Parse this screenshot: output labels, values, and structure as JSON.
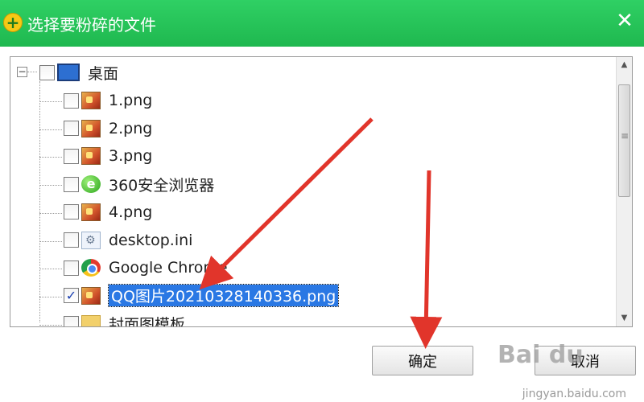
{
  "window": {
    "title": "选择要粉碎的文件",
    "close_label": "✕"
  },
  "tree": {
    "root": {
      "label": "桌面",
      "expander": "−",
      "checked": false
    },
    "items": [
      {
        "label": "1.png",
        "icon": "image-icon",
        "checked": false,
        "selected": false
      },
      {
        "label": "2.png",
        "icon": "image-icon",
        "checked": false,
        "selected": false
      },
      {
        "label": "3.png",
        "icon": "image-icon",
        "checked": false,
        "selected": false
      },
      {
        "label": "360安全浏览器",
        "icon": "360-browser-icon",
        "checked": false,
        "selected": false
      },
      {
        "label": "4.png",
        "icon": "image-icon",
        "checked": false,
        "selected": false
      },
      {
        "label": "desktop.ini",
        "icon": "ini-file-icon",
        "checked": false,
        "selected": false
      },
      {
        "label": "Google Chrome",
        "icon": "chrome-icon",
        "checked": false,
        "selected": false
      },
      {
        "label": "QQ图片20210328140336.png",
        "icon": "image-icon",
        "checked": true,
        "selected": true
      },
      {
        "label": "封面图模板",
        "icon": "folder-icon",
        "checked": false,
        "selected": false
      }
    ]
  },
  "buttons": {
    "ok_label": "确定",
    "cancel_label": "取消"
  },
  "watermark": {
    "brand": "Bai du",
    "sub": "jingyan.baidu.com"
  },
  "colors": {
    "titlebar": "#22c055",
    "selection": "#2a78e4",
    "arrow": "#e1352b"
  }
}
